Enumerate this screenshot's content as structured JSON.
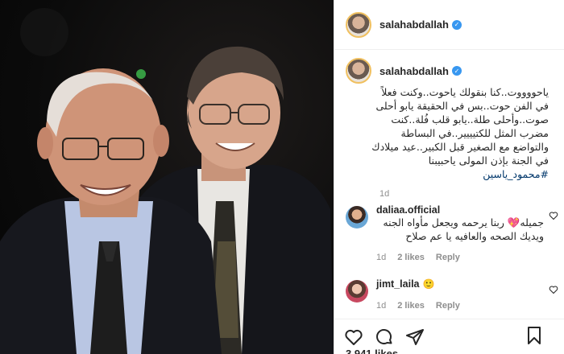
{
  "post": {
    "username": "salahabdallah",
    "verified_mark": "✓"
  },
  "caption": {
    "username": "salahabdallah",
    "text": "ياحووووت..كنا بنقولك ياحوت..وكنت فعلاً في الفن حوت..بس في الحقيقة يابو أحلى صوت..وأحلى طلة..يابو قلب فُلة..كنت مضرب المثل للكتيييير..في البساطة والتواضع مع الصغير قبل الكبير..عيد ميلادك في الجنة بإذن المولى ياحبيبنا",
    "hashtag": "#محمود_ياسين",
    "time": "1d"
  },
  "comments": [
    {
      "username": "daliaa.official",
      "text": "جميله💖 ربنا يرحمه ويجعل مأواه الجنه ويديك الصحه والعافيه يا عم صلاح",
      "time": "1d",
      "likes": "2 likes",
      "reply": "Reply"
    },
    {
      "username": "jimt_laila",
      "text": "🙂",
      "time": "1d",
      "likes": "2 likes",
      "reply": "Reply"
    }
  ],
  "actions": {
    "icons": [
      "heart-icon",
      "comment-icon",
      "share-icon",
      "bookmark-icon"
    ]
  },
  "footer": {
    "likes": "3,941 likes"
  },
  "colors": {
    "verified": "#3897f0",
    "hashtag": "#00376b",
    "meta": "#8e8e8e"
  }
}
